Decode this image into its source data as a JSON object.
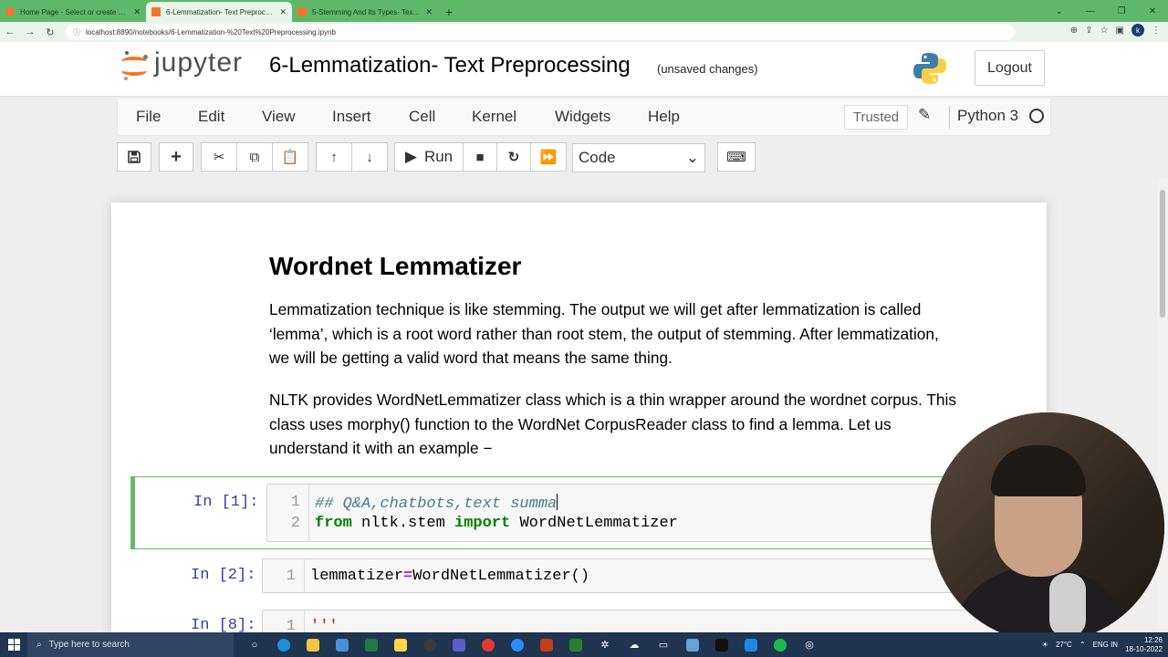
{
  "browser": {
    "tabs": [
      {
        "label": "Home Page - Select or create a n...",
        "active": false
      },
      {
        "label": "6-Lemmatization- Text Preprocess...",
        "active": true
      },
      {
        "label": "5-Stemming And Its Types- Text ...",
        "active": false
      }
    ],
    "new_tab_symbol": "+",
    "url": "localhost:8890/notebooks/6-Lemmatization-%20Text%20Preprocessing.ipynb",
    "profile_initial": "k"
  },
  "header": {
    "logo_text": "jupyter",
    "notebook_title": "6-Lemmatization- Text Preprocessing",
    "save_status": "(unsaved changes)",
    "logout_label": "Logout"
  },
  "menubar": {
    "items": [
      "File",
      "Edit",
      "View",
      "Insert",
      "Cell",
      "Kernel",
      "Widgets",
      "Help"
    ],
    "trusted_label": "Trusted",
    "kernel_name": "Python 3"
  },
  "toolbar": {
    "run_label": "Run",
    "cell_type": "Code"
  },
  "notebook": {
    "heading": "Wordnet Lemmatizer",
    "paragraph1": [
      "Lemmatization technique is like stemming. The output we will get after lemmatization is called",
      "‘lemma’, which is a root word rather than root stem, the output of stemming. After lemmatization,",
      "we will be getting a valid word that means the same thing."
    ],
    "paragraph2": [
      "NLTK provides WordNetLemmatizer class which is a thin wrapper around the wordnet corpus. This",
      "class uses morphy() function to the WordNet CorpusReader class to find a lemma. Let us",
      "understand it with an example −"
    ],
    "cells": [
      {
        "prompt": "In [1]:",
        "lines": [
          {
            "no": "1",
            "comment": "## Q&A,chatbots,text summa"
          },
          {
            "no": "2",
            "kw1": "from",
            "mod": " nltk.stem ",
            "kw2": "import",
            "name": " WordNetLemmatizer"
          }
        ]
      },
      {
        "prompt": "In [2]:",
        "lines": [
          {
            "no": "1",
            "lhs": "lemmatizer",
            "op": "=",
            "rhs": "WordNetLemmatizer()"
          }
        ]
      },
      {
        "prompt": "In [8]:",
        "lines": [
          {
            "no": "1",
            "str": "'''"
          }
        ]
      }
    ]
  },
  "taskbar": {
    "search_placeholder": "Type here to search",
    "temperature": "27°C",
    "lang": "ENG IN",
    "time": "12:26",
    "date": "18-10-2022"
  },
  "colors": {
    "browser_tab_bar": "#5fb86a",
    "jupyter_orange": "#f37626",
    "selected_cell": "#66bb6a",
    "prompt": "#303f9f",
    "keyword": "#008000",
    "comment": "#408080"
  }
}
